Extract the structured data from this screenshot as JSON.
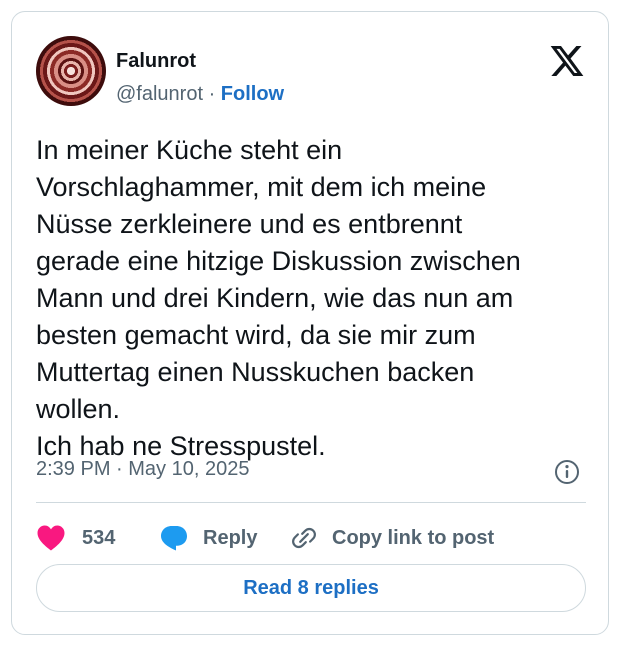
{
  "author": {
    "name": "Falunrot",
    "handle": "@falunrot",
    "separator": " · ",
    "follow_label": "Follow"
  },
  "tweet": {
    "text": "In meiner Küche steht ein\nVorschlaghammer, mit dem ich meine\nNüsse zerkleinere und es entbrennt\ngerade eine hitzige Diskussion zwischen\nMann und drei Kindern, wie das nun am\nbesten gemacht wird, da sie mir zum\nMuttertag einen Nusskuchen backen\nwollen.\nIch hab ne Stresspustel.",
    "timestamp": "2:39 PM · May 10, 2025"
  },
  "actions": {
    "like_count": "534",
    "reply_label": "Reply",
    "copy_label": "Copy link to post"
  },
  "footer": {
    "read_replies_label": "Read 8 replies"
  },
  "icons": {
    "avatar": "spiral-avatar",
    "logo": "x-logo-icon",
    "info": "info-icon",
    "like": "heart-icon",
    "reply": "speech-bubble-icon",
    "copy": "link-icon"
  },
  "colors": {
    "text": "#0f1419",
    "secondary_text": "#536471",
    "link": "#1d6fc4",
    "like": "#f91880",
    "reply_icon": "#1d9bf0",
    "border": "#cfd9de"
  }
}
